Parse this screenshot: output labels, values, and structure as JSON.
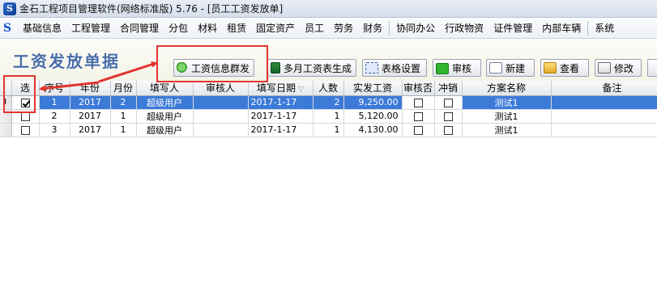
{
  "window": {
    "title": "金石工程项目管理软件(网络标准版) 5.76 - [员工工资发放单]"
  },
  "menu": [
    "基础信息",
    "工程管理",
    "合同管理",
    "分包",
    "材料",
    "租赁",
    "固定资产",
    "员工",
    "劳务",
    "财务",
    "协同办公",
    "行政物资",
    "证件管理",
    "内部车辆",
    "系统"
  ],
  "page": {
    "heading": "工资发放单据"
  },
  "toolbar": {
    "group_send": "工资信息群发",
    "multi_month": "多月工资表生成",
    "table_settings": "表格设置",
    "approve": "审核",
    "new": "新建",
    "view": "查看",
    "edit": "修改"
  },
  "table": {
    "columns": [
      "选",
      "序号",
      "年份",
      "月份",
      "填写人",
      "审核人",
      "填写日期",
      "人数",
      "实发工资",
      "审核否",
      "冲销",
      "方案名称",
      "备注"
    ],
    "rows": [
      {
        "selected": true,
        "checked": true,
        "indicator": "I",
        "seq": "1",
        "year": "2017",
        "month": "2",
        "writer": "超级用户",
        "reviewer": "",
        "date": "2017-1-17",
        "count": "2",
        "amount": "9,250.00",
        "audited": false,
        "reversed": false,
        "plan": "测试1",
        "note": ""
      },
      {
        "selected": false,
        "checked": false,
        "indicator": "",
        "seq": "2",
        "year": "2017",
        "month": "1",
        "writer": "超级用户",
        "reviewer": "",
        "date": "2017-1-17",
        "count": "1",
        "amount": "5,120.00",
        "audited": false,
        "reversed": false,
        "plan": "测试1",
        "note": ""
      },
      {
        "selected": false,
        "checked": false,
        "indicator": "",
        "seq": "3",
        "year": "2017",
        "month": "1",
        "writer": "超级用户",
        "reviewer": "",
        "date": "2017-1-17",
        "count": "1",
        "amount": "4,130.00",
        "audited": false,
        "reversed": false,
        "plan": "测试1",
        "note": ""
      }
    ]
  },
  "annotation": {
    "color": "#e3342f",
    "arrow_color": "#e3342f"
  }
}
